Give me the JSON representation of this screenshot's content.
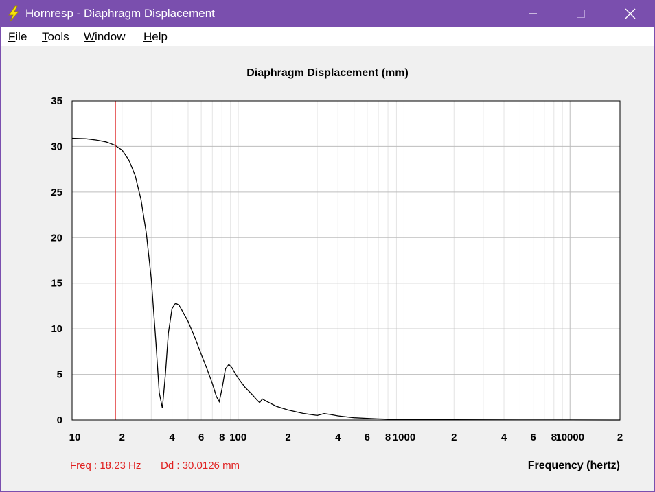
{
  "window": {
    "title": "Hornresp - Diaphragm Displacement",
    "app_icon": "lightning-bolt-icon",
    "title_bar_color": "#7a4fae"
  },
  "menu": {
    "items": [
      {
        "label": "File",
        "accel": "F",
        "rest": "ile"
      },
      {
        "label": "Tools",
        "accel": "T",
        "rest": "ools"
      },
      {
        "label": "Window",
        "accel": "W",
        "rest": "indow"
      },
      {
        "label": "Help",
        "accel": "H",
        "rest": "elp"
      }
    ]
  },
  "readout": {
    "freq": "Freq : 18.23 Hz",
    "dd": "Dd : 30.0126 mm",
    "color": "#e02020"
  },
  "chart_data": {
    "type": "line",
    "title": "Diaphragm Displacement (mm)",
    "xlabel": "Frequency (hertz)",
    "ylabel": "",
    "x_scale": "log",
    "xlim": [
      10,
      20000
    ],
    "ylim": [
      0,
      35
    ],
    "yticks": [
      "0",
      "5",
      "10",
      "15",
      "20",
      "25",
      "30",
      "35"
    ],
    "xticks": [
      {
        "v": 10,
        "label": "10"
      },
      {
        "v": 20,
        "label": "2"
      },
      {
        "v": 40,
        "label": "4"
      },
      {
        "v": 60,
        "label": "6"
      },
      {
        "v": 80,
        "label": "8"
      },
      {
        "v": 100,
        "label": "100"
      },
      {
        "v": 200,
        "label": "2"
      },
      {
        "v": 400,
        "label": "4"
      },
      {
        "v": 600,
        "label": "6"
      },
      {
        "v": 800,
        "label": "8"
      },
      {
        "v": 1000,
        "label": "1000"
      },
      {
        "v": 2000,
        "label": "2"
      },
      {
        "v": 4000,
        "label": "4"
      },
      {
        "v": 6000,
        "label": "6"
      },
      {
        "v": 8000,
        "label": "8"
      },
      {
        "v": 10000,
        "label": "10000"
      },
      {
        "v": 20000,
        "label": "2"
      }
    ],
    "grid": true,
    "cursor_x": 18.23,
    "cursor_color": "#dd2222",
    "series": [
      {
        "color": "#000000",
        "x": [
          10,
          12,
          14,
          16,
          18,
          20,
          22,
          24,
          26,
          28,
          30,
          32,
          33.5,
          35,
          36.5,
          38,
          40,
          42,
          44,
          46,
          50,
          55,
          60,
          65,
          70,
          74,
          77,
          80,
          84,
          88,
          92,
          96,
          100,
          110,
          120,
          130,
          135,
          140,
          150,
          170,
          200,
          250,
          300,
          330,
          360,
          400,
          500,
          600,
          700,
          800,
          1000,
          2000,
          5000,
          10000,
          20000
        ],
        "y": [
          30.9,
          30.85,
          30.7,
          30.5,
          30.15,
          29.6,
          28.5,
          26.8,
          24.2,
          20.5,
          15.5,
          8.5,
          3.0,
          1.3,
          5.0,
          9.5,
          12.2,
          12.8,
          12.6,
          12.0,
          10.8,
          9.0,
          7.2,
          5.6,
          4.0,
          2.6,
          2.0,
          3.4,
          5.6,
          6.1,
          5.7,
          5.1,
          4.6,
          3.6,
          2.9,
          2.2,
          1.9,
          2.3,
          2.0,
          1.5,
          1.1,
          0.7,
          0.5,
          0.7,
          0.6,
          0.45,
          0.25,
          0.18,
          0.12,
          0.09,
          0.05,
          0.02,
          0.01,
          0.005,
          0.003
        ]
      }
    ]
  }
}
